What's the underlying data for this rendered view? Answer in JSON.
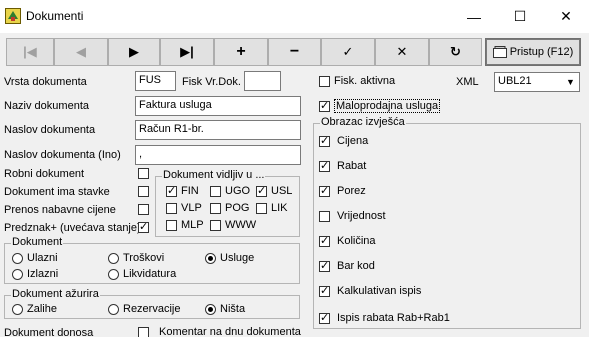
{
  "window": {
    "title": "Dokumenti",
    "minimize": "—",
    "maximize": "☐",
    "close": "✕"
  },
  "toolbar": {
    "first": "|◀",
    "prev": "◀",
    "next": "▶",
    "last": "▶|",
    "add": "+",
    "delete": "−",
    "confirm": "✓",
    "cancel": "✕",
    "refresh": "↻",
    "pristup": "Pristup (F12)"
  },
  "form": {
    "vrsta_label": "Vrsta dokumenta",
    "vrsta_value": "FUS",
    "fisk_vr_label": "Fisk Vr.Dok.",
    "fisk_vr_value": "",
    "naziv_label": "Naziv dokumenta",
    "naziv_value": "Faktura usluga",
    "naslov_label": "Naslov dokumenta",
    "naslov_value": "Račun R1-br.",
    "naslov_ino_label": "Naslov dokumenta (Ino)",
    "naslov_ino_value": ",",
    "robni_label": "Robni dokument",
    "stavke_label": "Dokument ima stavke",
    "prenos_label": "Prenos nabavne cijene",
    "predznak_label": "Predznak+ (uvećava stanje)",
    "donosa_label": "Dokument donosa"
  },
  "vidljiv": {
    "title": "Dokument vidljiv u ...",
    "items": [
      {
        "label": "FIN",
        "checked": true
      },
      {
        "label": "UGO",
        "checked": false
      },
      {
        "label": "USL",
        "checked": true
      },
      {
        "label": "VLP",
        "checked": false
      },
      {
        "label": "POG",
        "checked": false
      },
      {
        "label": "LIK",
        "checked": false
      },
      {
        "label": "MLP",
        "checked": false
      },
      {
        "label": "WWW",
        "checked": false
      }
    ]
  },
  "dokument": {
    "title": "Dokument",
    "ulazni": "Ulazni",
    "troskovi": "Troškovi",
    "usluge": "Usluge",
    "izlazni": "Izlazni",
    "likvidatura": "Likvidatura"
  },
  "azurira": {
    "title": "Dokument ažurira",
    "zalihe": "Zalihe",
    "rezervacije": "Rezervacije",
    "nista": "Ništa"
  },
  "right": {
    "fisk_aktivna": "Fisk. aktivna",
    "xml_label": "XML",
    "xml_value": "UBL21",
    "maloprodajna": "Maloprodajna usluga",
    "komentar": "Komentar na dnu dokumenta"
  },
  "obrazac": {
    "title": "Obrazac izvješća",
    "items": [
      {
        "label": "Cijena",
        "checked": true
      },
      {
        "label": "Rabat",
        "checked": true
      },
      {
        "label": "Porez",
        "checked": true
      },
      {
        "label": "Vrijednost",
        "checked": false
      },
      {
        "label": "Količina",
        "checked": true
      },
      {
        "label": "Bar kod",
        "checked": true
      },
      {
        "label": "Kalkulativan ispis",
        "checked": true
      },
      {
        "label": "Ispis rabata Rab+Rab1",
        "checked": true
      }
    ]
  }
}
